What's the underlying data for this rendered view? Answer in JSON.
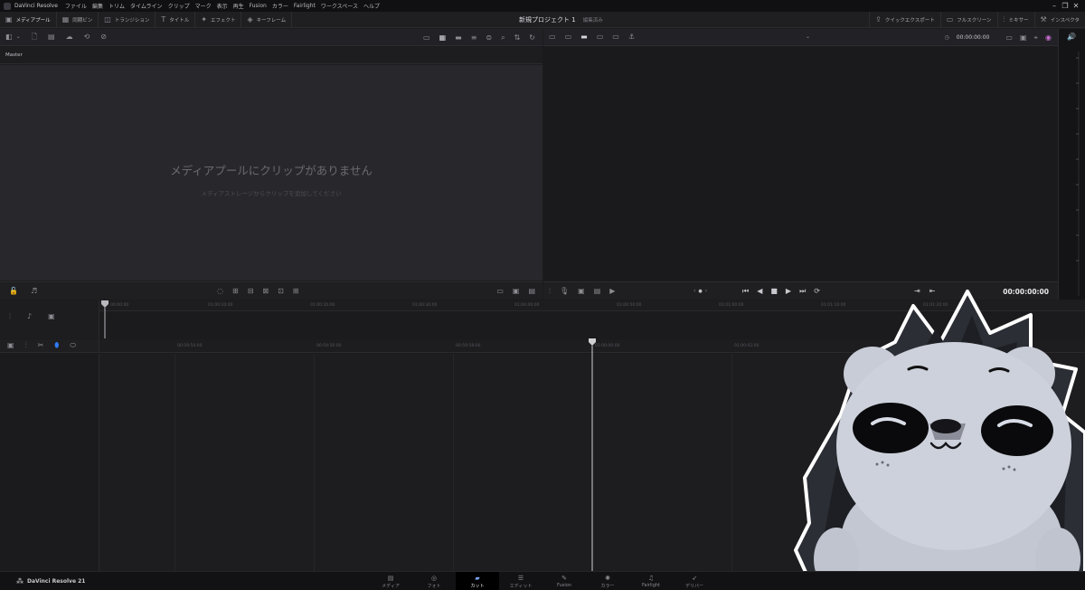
{
  "app": {
    "title": "DaVinci Resolve",
    "menus": [
      "ファイル",
      "編集",
      "トリム",
      "タイムライン",
      "クリップ",
      "マーク",
      "表示",
      "再生",
      "Fusion",
      "カラー",
      "Fairlight",
      "ワークスペース",
      "ヘルプ"
    ],
    "project_name": "新規プロジェクト 1",
    "project_status": "編集済み"
  },
  "toolbar": {
    "left": [
      {
        "label": "メディアプール",
        "icon": "media-pool-icon",
        "active": true
      },
      {
        "label": "同期ビン",
        "icon": "sync-bin-icon",
        "active": false
      },
      {
        "label": "トランジション",
        "icon": "transition-icon",
        "active": false
      },
      {
        "label": "タイトル",
        "icon": "title-icon",
        "active": false
      },
      {
        "label": "エフェクト",
        "icon": "effects-icon",
        "active": false
      },
      {
        "label": "キーフレーム",
        "icon": "keyframe-icon",
        "active": false
      }
    ],
    "right": [
      {
        "label": "クイックエクスポート",
        "icon": "export-icon"
      },
      {
        "label": "フルスクリーン",
        "icon": "fullscreen-icon"
      },
      {
        "label": "ミキサー",
        "icon": "mixer-icon"
      },
      {
        "label": "インスペクタ",
        "icon": "inspector-icon"
      }
    ]
  },
  "media_pool": {
    "bin": "Master",
    "empty_title": "メディアプールにクリップがありません",
    "empty_sub": "メディアストレージからクリップを追加してください"
  },
  "viewer": {
    "timecode_top": "00:00:00:00",
    "timecode_main": "00:00:00:00"
  },
  "timeline": {
    "top_ruler": [
      "00:00:00",
      "01:00:10:00",
      "01:00:20:00",
      "01:00:30:00",
      "01:00:40:00",
      "01:00:50:00",
      "01:01:00:00",
      "01:01:10:00",
      "01:01:20:00"
    ],
    "main_ruler": [
      "00:59:54:00",
      "00:59:56:00",
      "00:59:58:00",
      "01:00:00:00",
      "01:00:02:00"
    ]
  },
  "pages": [
    {
      "label": "メディア",
      "icon": "media-page-icon",
      "active": false
    },
    {
      "label": "フォト",
      "icon": "photo-page-icon",
      "active": false
    },
    {
      "label": "カット",
      "icon": "cut-page-icon",
      "active": true
    },
    {
      "label": "エディット",
      "icon": "edit-page-icon",
      "active": false
    },
    {
      "label": "Fusion",
      "icon": "fusion-page-icon",
      "active": false
    },
    {
      "label": "カラー",
      "icon": "color-page-icon",
      "active": false
    },
    {
      "label": "Fairlight",
      "icon": "fairlight-page-icon",
      "active": false
    },
    {
      "label": "デリバー",
      "icon": "deliver-page-icon",
      "active": false
    }
  ],
  "brand": {
    "label": "DaVinci Resolve 21"
  },
  "colors": {
    "accent_blue": "#2f7cf6",
    "playhead": "#d0d0d4",
    "mascot": "#c8ccd6"
  }
}
